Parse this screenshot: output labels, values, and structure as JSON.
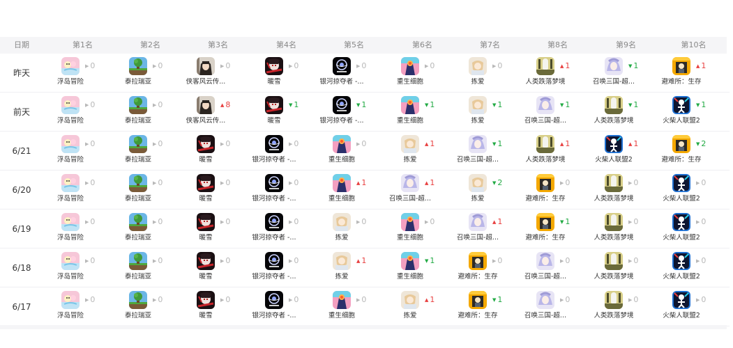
{
  "header": {
    "date_label": "日期",
    "rank_labels": [
      "第1名",
      "第2名",
      "第3名",
      "第4名",
      "第5名",
      "第6名",
      "第7名",
      "第8名",
      "第9名",
      "第10名"
    ]
  },
  "change_colors": {
    "same": "#b8b8b8",
    "up": "#e84040",
    "down": "#22aa44"
  },
  "rows": [
    {
      "date": "昨天",
      "cells": [
        {
          "name": "浮岛冒险",
          "icon": "fudao-icon",
          "dir": "same",
          "delta": "0"
        },
        {
          "name": "泰拉瑞亚",
          "icon": "terraria-icon",
          "dir": "same",
          "delta": "0"
        },
        {
          "name": "侠客风云传...",
          "icon": "xiake-icon",
          "dir": "same",
          "delta": "0"
        },
        {
          "name": "暖雪",
          "icon": "nuanxue-icon",
          "dir": "same",
          "delta": "0"
        },
        {
          "name": "银河掠夺者 -...",
          "icon": "galaxy-icon",
          "dir": "same",
          "delta": "0"
        },
        {
          "name": "重生细胞",
          "icon": "deadcells-icon",
          "dir": "same",
          "delta": "0"
        },
        {
          "name": "拣爱",
          "icon": "jianai-icon",
          "dir": "same",
          "delta": "0"
        },
        {
          "name": "人类跌落梦境",
          "icon": "hff-icon",
          "dir": "up",
          "delta": "1"
        },
        {
          "name": "召唤三国-超...",
          "icon": "zhaohuan-icon",
          "dir": "down",
          "delta": "1"
        },
        {
          "name": "避难所：生存",
          "icon": "bunker-icon",
          "dir": "up",
          "delta": "1"
        }
      ]
    },
    {
      "date": "前天",
      "cells": [
        {
          "name": "浮岛冒险",
          "icon": "fudao-icon",
          "dir": "same",
          "delta": "0"
        },
        {
          "name": "泰拉瑞亚",
          "icon": "terraria-icon",
          "dir": "same",
          "delta": "0"
        },
        {
          "name": "侠客风云传...",
          "icon": "xiake-icon",
          "dir": "up",
          "delta": "8"
        },
        {
          "name": "暖雪",
          "icon": "nuanxue-icon",
          "dir": "down",
          "delta": "1"
        },
        {
          "name": "银河掠夺者 -...",
          "icon": "galaxy-icon",
          "dir": "down",
          "delta": "1"
        },
        {
          "name": "重生细胞",
          "icon": "deadcells-icon",
          "dir": "down",
          "delta": "1"
        },
        {
          "name": "拣爱",
          "icon": "jianai-icon",
          "dir": "down",
          "delta": "1"
        },
        {
          "name": "召唤三国-超...",
          "icon": "zhaohuan-icon",
          "dir": "down",
          "delta": "1"
        },
        {
          "name": "人类跌落梦境",
          "icon": "hff-icon",
          "dir": "down",
          "delta": "1"
        },
        {
          "name": "火柴人联盟2",
          "icon": "stickman-icon",
          "dir": "down",
          "delta": "1"
        }
      ]
    },
    {
      "date": "6/21",
      "cells": [
        {
          "name": "浮岛冒险",
          "icon": "fudao-icon",
          "dir": "same",
          "delta": "0"
        },
        {
          "name": "泰拉瑞亚",
          "icon": "terraria-icon",
          "dir": "same",
          "delta": "0"
        },
        {
          "name": "暖雪",
          "icon": "nuanxue-icon",
          "dir": "same",
          "delta": "0"
        },
        {
          "name": "银河掠夺者 -...",
          "icon": "galaxy-icon",
          "dir": "same",
          "delta": "0"
        },
        {
          "name": "重生细胞",
          "icon": "deadcells-icon",
          "dir": "same",
          "delta": "0"
        },
        {
          "name": "拣爱",
          "icon": "jianai-icon",
          "dir": "up",
          "delta": "1"
        },
        {
          "name": "召唤三国-超...",
          "icon": "zhaohuan-icon",
          "dir": "down",
          "delta": "1"
        },
        {
          "name": "人类跌落梦境",
          "icon": "hff-icon",
          "dir": "up",
          "delta": "1"
        },
        {
          "name": "火柴人联盟2",
          "icon": "stickman-icon",
          "dir": "up",
          "delta": "1"
        },
        {
          "name": "避难所：生存",
          "icon": "bunker-icon",
          "dir": "down",
          "delta": "2"
        }
      ]
    },
    {
      "date": "6/20",
      "cells": [
        {
          "name": "浮岛冒险",
          "icon": "fudao-icon",
          "dir": "same",
          "delta": "0"
        },
        {
          "name": "泰拉瑞亚",
          "icon": "terraria-icon",
          "dir": "same",
          "delta": "0"
        },
        {
          "name": "暖雪",
          "icon": "nuanxue-icon",
          "dir": "same",
          "delta": "0"
        },
        {
          "name": "银河掠夺者 -...",
          "icon": "galaxy-icon",
          "dir": "same",
          "delta": "0"
        },
        {
          "name": "重生细胞",
          "icon": "deadcells-icon",
          "dir": "up",
          "delta": "1"
        },
        {
          "name": "召唤三国-超...",
          "icon": "zhaohuan-icon",
          "dir": "up",
          "delta": "1"
        },
        {
          "name": "拣爱",
          "icon": "jianai-icon",
          "dir": "down",
          "delta": "2"
        },
        {
          "name": "避难所：生存",
          "icon": "bunker-icon",
          "dir": "same",
          "delta": "0"
        },
        {
          "name": "人类跌落梦境",
          "icon": "hff-icon",
          "dir": "same",
          "delta": "0"
        },
        {
          "name": "火柴人联盟2",
          "icon": "stickman-icon",
          "dir": "same",
          "delta": "0"
        }
      ]
    },
    {
      "date": "6/19",
      "cells": [
        {
          "name": "浮岛冒险",
          "icon": "fudao-icon",
          "dir": "same",
          "delta": "0"
        },
        {
          "name": "泰拉瑞亚",
          "icon": "terraria-icon",
          "dir": "same",
          "delta": "0"
        },
        {
          "name": "暖雪",
          "icon": "nuanxue-icon",
          "dir": "same",
          "delta": "0"
        },
        {
          "name": "银河掠夺者 -...",
          "icon": "galaxy-icon",
          "dir": "same",
          "delta": "0"
        },
        {
          "name": "拣爱",
          "icon": "jianai-icon",
          "dir": "same",
          "delta": "0"
        },
        {
          "name": "重生细胞",
          "icon": "deadcells-icon",
          "dir": "same",
          "delta": "0"
        },
        {
          "name": "召唤三国-超...",
          "icon": "zhaohuan-icon",
          "dir": "up",
          "delta": "1"
        },
        {
          "name": "避难所：生存",
          "icon": "bunker-icon",
          "dir": "down",
          "delta": "1"
        },
        {
          "name": "人类跌落梦境",
          "icon": "hff-icon",
          "dir": "same",
          "delta": "0"
        },
        {
          "name": "火柴人联盟2",
          "icon": "stickman-icon",
          "dir": "same",
          "delta": "0"
        }
      ]
    },
    {
      "date": "6/18",
      "cells": [
        {
          "name": "浮岛冒险",
          "icon": "fudao-icon",
          "dir": "same",
          "delta": "0"
        },
        {
          "name": "泰拉瑞亚",
          "icon": "terraria-icon",
          "dir": "same",
          "delta": "0"
        },
        {
          "name": "暖雪",
          "icon": "nuanxue-icon",
          "dir": "same",
          "delta": "0"
        },
        {
          "name": "银河掠夺者 -...",
          "icon": "galaxy-icon",
          "dir": "same",
          "delta": "0"
        },
        {
          "name": "拣爱",
          "icon": "jianai-icon",
          "dir": "up",
          "delta": "1"
        },
        {
          "name": "重生细胞",
          "icon": "deadcells-icon",
          "dir": "down",
          "delta": "1"
        },
        {
          "name": "避难所：生存",
          "icon": "bunker-icon",
          "dir": "same",
          "delta": "0"
        },
        {
          "name": "召唤三国-超...",
          "icon": "zhaohuan-icon",
          "dir": "same",
          "delta": "0"
        },
        {
          "name": "人类跌落梦境",
          "icon": "hff-icon",
          "dir": "same",
          "delta": "0"
        },
        {
          "name": "火柴人联盟2",
          "icon": "stickman-icon",
          "dir": "same",
          "delta": "0"
        }
      ]
    },
    {
      "date": "6/17",
      "cells": [
        {
          "name": "浮岛冒险",
          "icon": "fudao-icon",
          "dir": "same",
          "delta": "0"
        },
        {
          "name": "泰拉瑞亚",
          "icon": "terraria-icon",
          "dir": "same",
          "delta": "0"
        },
        {
          "name": "暖雪",
          "icon": "nuanxue-icon",
          "dir": "same",
          "delta": "0"
        },
        {
          "name": "银河掠夺者 -...",
          "icon": "galaxy-icon",
          "dir": "same",
          "delta": "0"
        },
        {
          "name": "重生细胞",
          "icon": "deadcells-icon",
          "dir": "same",
          "delta": "0"
        },
        {
          "name": "拣爱",
          "icon": "jianai-icon",
          "dir": "up",
          "delta": "1"
        },
        {
          "name": "避难所：生存",
          "icon": "bunker-icon",
          "dir": "down",
          "delta": "1"
        },
        {
          "name": "召唤三国-超...",
          "icon": "zhaohuan-icon",
          "dir": "same",
          "delta": "0"
        },
        {
          "name": "人类跌落梦境",
          "icon": "hff-icon",
          "dir": "same",
          "delta": "0"
        },
        {
          "name": "火柴人联盟2",
          "icon": "stickman-icon",
          "dir": "same",
          "delta": "0"
        }
      ]
    }
  ]
}
